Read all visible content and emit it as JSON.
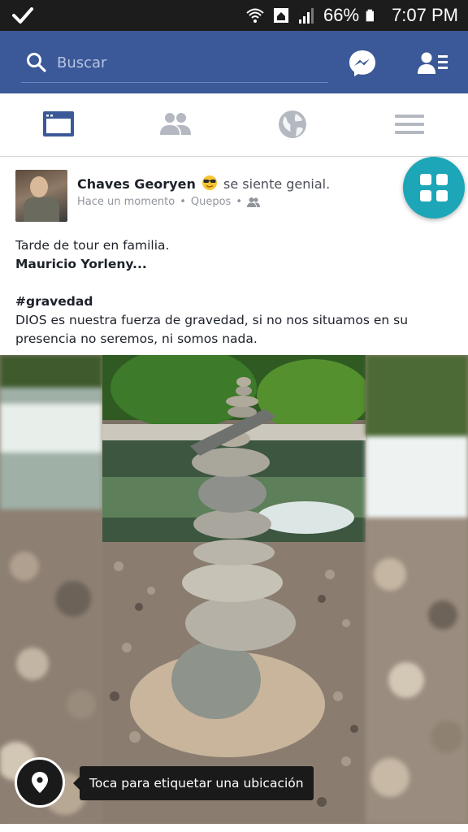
{
  "status_bar": {
    "battery": "66%",
    "time": "7:07 PM"
  },
  "header": {
    "search_placeholder": "Buscar",
    "icons": [
      "search-icon",
      "messenger-icon",
      "friend-requests-icon"
    ]
  },
  "tabs": [
    {
      "icon": "news-feed-icon",
      "active": true
    },
    {
      "icon": "friends-icon",
      "active": false
    },
    {
      "icon": "globe-icon",
      "active": false
    },
    {
      "icon": "menu-icon",
      "active": false
    }
  ],
  "post": {
    "author": "Chaves Georyen",
    "feeling": "se siente genial.",
    "time": "Hace un momento",
    "location": "Quepos",
    "separator": "•",
    "text_line1": "Tarde de tour en familia.",
    "tagged": "Mauricio Yorleny...",
    "hashtag": "#gravedad",
    "body": "DIOS es nuestra fuerza de gravedad, si no nos situamos en su presencia no seremos, ni somos nada."
  },
  "location_tip": "Toca para etiquetar una ubicación",
  "colors": {
    "brand": "#3b5998",
    "fab": "#1ca6b8",
    "status_bar": "#1c1c1c"
  }
}
